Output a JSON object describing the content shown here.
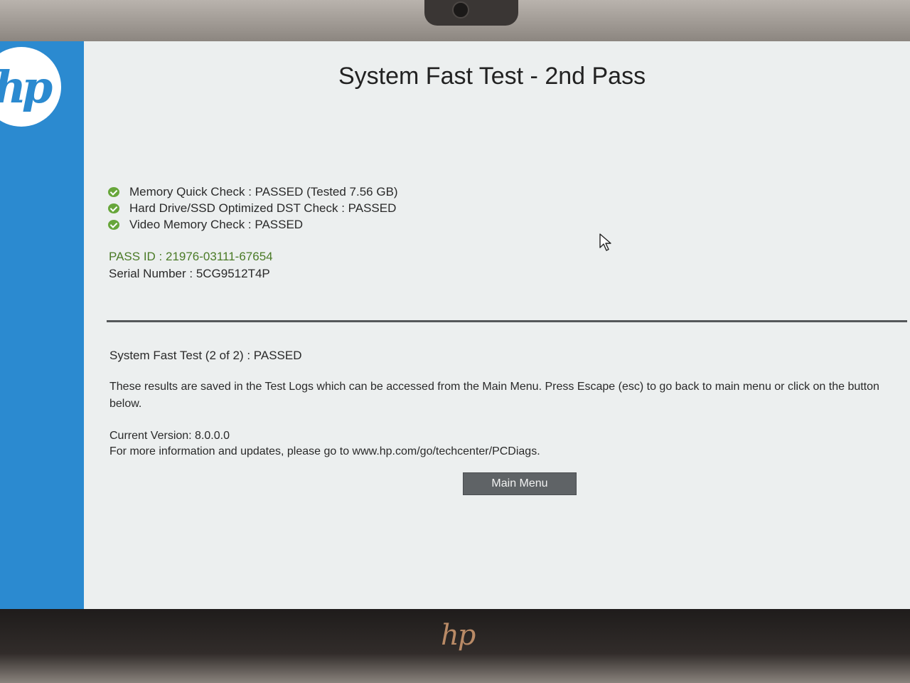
{
  "device": {
    "sidebar_logo": "hp",
    "bezel_logo": "hp"
  },
  "header": {
    "title": "System Fast Test - 2nd Pass"
  },
  "checks": [
    {
      "label": "Memory Quick Check : PASSED (Tested 7.56 GB)",
      "status": "passed"
    },
    {
      "label": "Hard Drive/SSD Optimized DST Check : PASSED",
      "status": "passed"
    },
    {
      "label": "Video Memory Check : PASSED",
      "status": "passed"
    }
  ],
  "ids": {
    "pass_id": "PASS ID : 21976-03111-67654",
    "serial_number": "Serial Number : 5CG9512T4P"
  },
  "results": {
    "summary": "System Fast Test (2 of 2) : PASSED",
    "notice": "These results are saved in the Test Logs which can be accessed from the Main Menu. Press Escape (esc) to go back to main menu or click on the button below.",
    "version": "Current Version: 8.0.0.0",
    "more_info": "For more information and updates, please go to www.hp.com/go/techcenter/PCDiags."
  },
  "actions": {
    "main_menu_label": "Main Menu"
  },
  "colors": {
    "sidebar_blue": "#2b8ad0",
    "pass_green": "#67a63a",
    "pass_id_text": "#4a7a26",
    "button_gray": "#5f6366"
  },
  "icons": {
    "check": "check-circle-icon",
    "cursor": "mouse-pointer-icon"
  }
}
